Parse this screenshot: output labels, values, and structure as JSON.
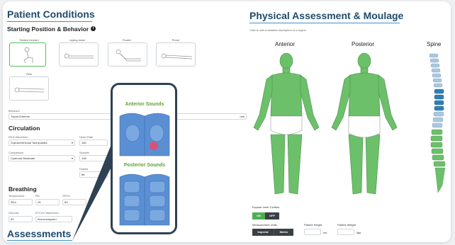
{
  "left": {
    "title": "Patient Conditions",
    "starting": "Starting Position & Behavior",
    "info_icon": "i",
    "positions": [
      "Seated forward",
      "Laying down",
      "Fowler",
      "Prone",
      "Side"
    ],
    "behavior": {
      "label": "Behavior",
      "value": "Tripod Extreme",
      "suffix": "min"
    },
    "circulation": {
      "title": "Circulation",
      "ekg_label": "EKG Waveform",
      "ekg_value": "Supraventricular Tachycardia",
      "hr_label": "Heart Rate",
      "hr_value": "160",
      "complexion_label": "Complexion",
      "complexion_value": "Cyanosis Moderate",
      "systolic_label": "Systolic",
      "systolic_value": "136",
      "diastolic_label": "Diastol",
      "diastolic_value": "86"
    },
    "breathing": {
      "title": "Breathing",
      "temp_label": "Temperature",
      "temp_value": "98.6",
      "rr_label": "RR",
      "rr_value": "26",
      "spo2_label": "SPO2",
      "spo2_value": "83",
      "glucose_label": "Glucose",
      "glucose_value": "82",
      "etco2_label": "ETCO2 Waveform",
      "etco2_value": "Bronchospasm"
    },
    "assessments": "Assessments"
  },
  "callout": {
    "anterior": "Anterior Sounds",
    "posterior": "Posterior Sounds"
  },
  "right": {
    "title": "Physical Assessment & Moulage",
    "hint": "Click to add a detailed description of a region.",
    "anterior": "Anterior",
    "posterior": "Posterior",
    "spine": "Spine",
    "expose_label": "Expose Inner Clothes",
    "on": "ON",
    "off": "OFF",
    "units_label": "Measurement Units",
    "imperial": "Imperial",
    "metric": "Metric",
    "height_label": "Patient Height",
    "height_unit": "cm.",
    "weight_label": "Patient Weight",
    "weight_unit": "kgs."
  },
  "colors": {
    "accent": "#1f4b6e",
    "green": "#6cc06a",
    "toggle_on": "#4caf50",
    "toggle_dark": "#3b3f44"
  }
}
